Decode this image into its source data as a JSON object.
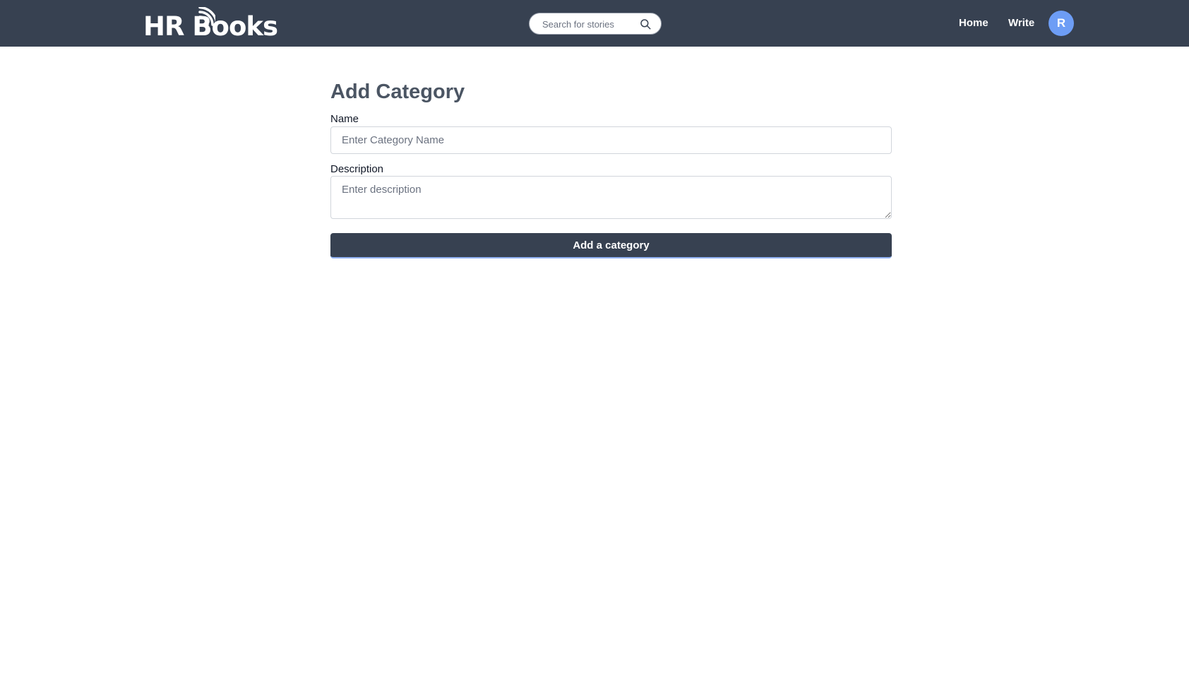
{
  "header": {
    "logo_text": "HR Books",
    "search": {
      "placeholder": "Search for stories",
      "value": ""
    },
    "nav": {
      "home_label": "Home",
      "write_label": "Write"
    },
    "avatar_initial": "R"
  },
  "form": {
    "title": "Add Category",
    "name": {
      "label": "Name",
      "placeholder": "Enter Category Name",
      "value": ""
    },
    "description": {
      "label": "Description",
      "placeholder": "Enter description",
      "value": ""
    },
    "submit_label": "Add a category"
  },
  "colors": {
    "navbar": "#374151",
    "avatar": "#6d9df5",
    "button": "#374151",
    "button_accent": "#93b4f5"
  }
}
